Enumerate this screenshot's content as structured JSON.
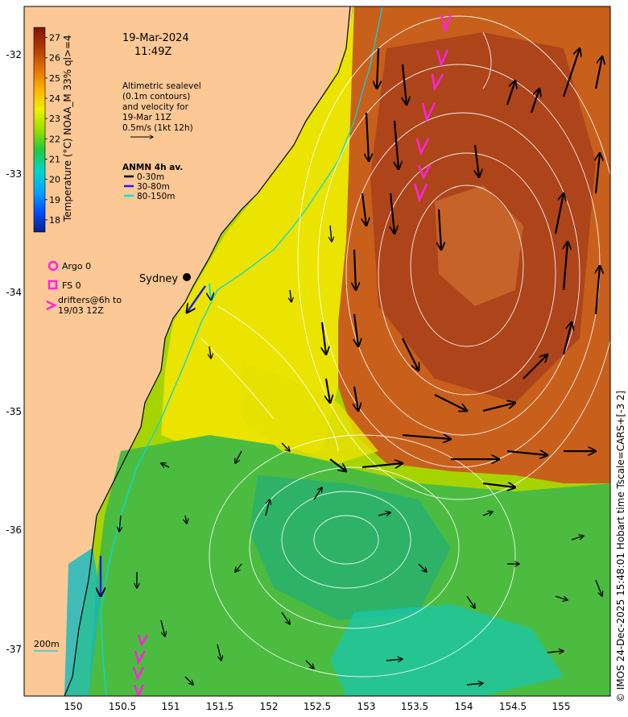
{
  "header": {
    "date": "19-Mar-2024",
    "time": "11:49Z"
  },
  "altimetry": {
    "lines": [
      "Altimetric sealevel",
      "(0.1m contours)",
      "and velocity for",
      "19-Mar 11Z",
      "0.5m/s (1kt 12h)"
    ]
  },
  "anmn": {
    "title": "ANMN 4h av.",
    "items": [
      {
        "label": "0-30m",
        "color": "#000000"
      },
      {
        "label": "30-80m",
        "color": "#1a1aff"
      },
      {
        "label": "80-150m",
        "color": "#00e5e5"
      }
    ]
  },
  "platforms": {
    "argo": "Argo 0",
    "fs": "FS 0",
    "drifters": [
      "drifters@6h to",
      "19/03 12Z"
    ],
    "color": "#ff22dd"
  },
  "city": "Sydney",
  "isobath_label": "200m",
  "credit": "© IMOS 24-Dec-2025 15:48:01 Hobart time Tscale=CARS+[-3 2]",
  "colorbar": {
    "title": "Temperature (°C) NOAA_M 33% ql>=4",
    "ticks": [
      "18",
      "19",
      "20",
      "21",
      "22",
      "23",
      "24",
      "25",
      "26",
      "27"
    ],
    "min": 17.4,
    "max": 27.5
  },
  "axes": {
    "x_ticks": [
      "150",
      "150.5",
      "151",
      "151.5",
      "152",
      "152.5",
      "153",
      "153.5",
      "154",
      "154.5",
      "155"
    ],
    "y_ticks": [
      "-32",
      "-33",
      "-34",
      "-35",
      "-36",
      "-37"
    ]
  }
}
